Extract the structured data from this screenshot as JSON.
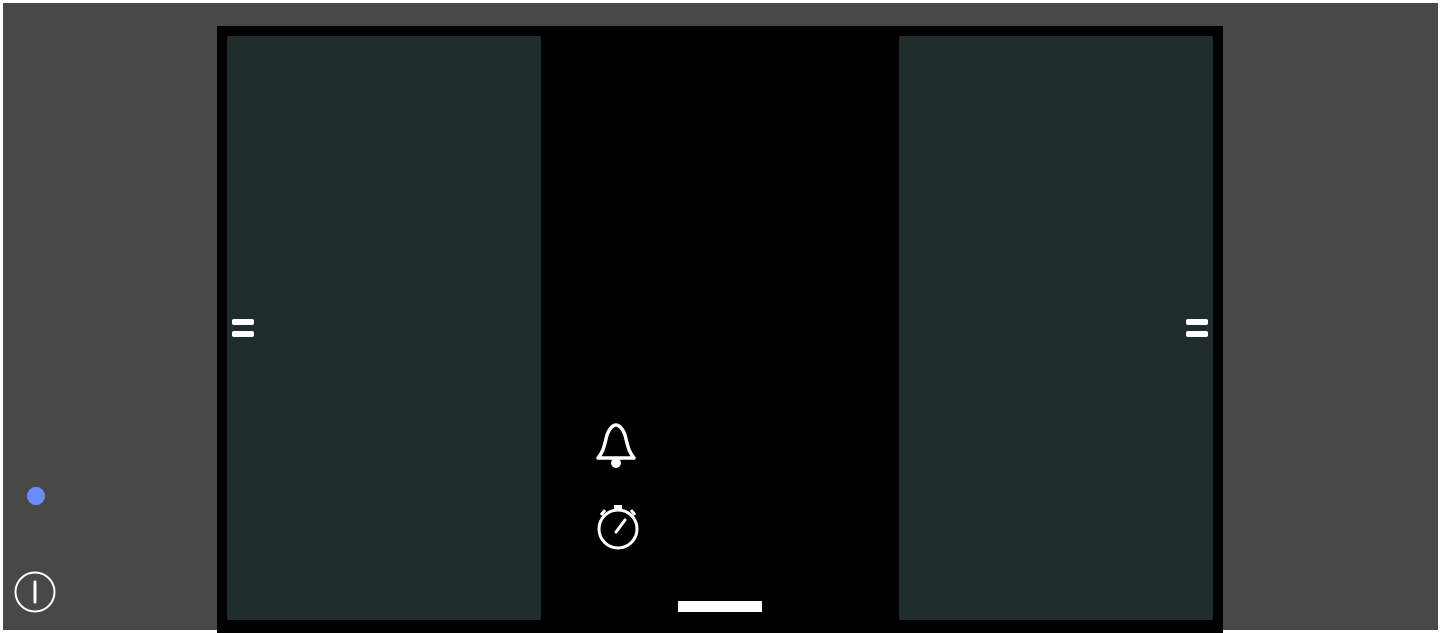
{
  "colors": {
    "background": "#484846",
    "device_frame": "#000000",
    "panel": "#202b2b",
    "icon": "#ffffff",
    "status_dot": "#6b8df5"
  },
  "icons": {
    "power": "power-icon",
    "status": "status-dot",
    "left_handle": "drag-handle-icon",
    "right_handle": "drag-handle-icon",
    "alarm": "bell-icon",
    "stopwatch": "stopwatch-icon",
    "home": "home-indicator"
  }
}
